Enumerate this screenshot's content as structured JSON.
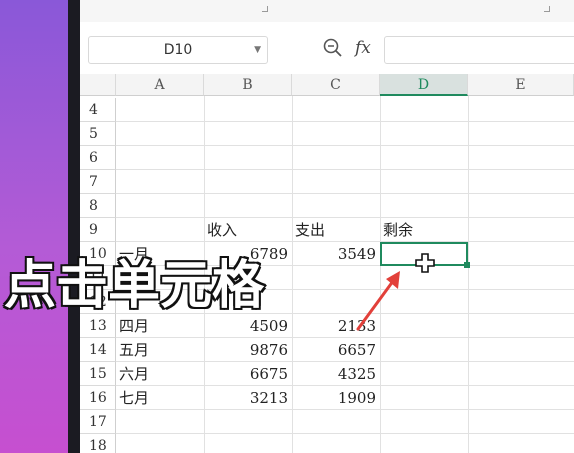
{
  "formula_bar": {
    "name_box": "D10",
    "fx_label": "fx",
    "formula_value": ""
  },
  "columns": [
    "A",
    "B",
    "C",
    "D",
    "E"
  ],
  "active_column": "D",
  "rows": [
    "4",
    "5",
    "6",
    "7",
    "8",
    "9",
    "10",
    "11",
    "12",
    "13",
    "14",
    "15",
    "16",
    "17",
    "18"
  ],
  "headers_row9": {
    "B": "收入",
    "C": "支出",
    "D": "剩余"
  },
  "data_rows": [
    {
      "row": "13",
      "month": "四月",
      "income": "4509",
      "expense": "2133"
    },
    {
      "row": "14",
      "month": "五月",
      "income": "9876",
      "expense": "6657"
    },
    {
      "row": "15",
      "month": "六月",
      "income": "6675",
      "expense": "4325"
    },
    {
      "row": "16",
      "month": "七月",
      "income": "3213",
      "expense": "1909"
    }
  ],
  "partial_row10": {
    "month": "一月",
    "income": "6789",
    "expense": "3549"
  },
  "caption": "点击单元格",
  "colors": {
    "accent": "#1f8a5e",
    "arrow": "#e2403a",
    "background": "#9b59d6"
  }
}
